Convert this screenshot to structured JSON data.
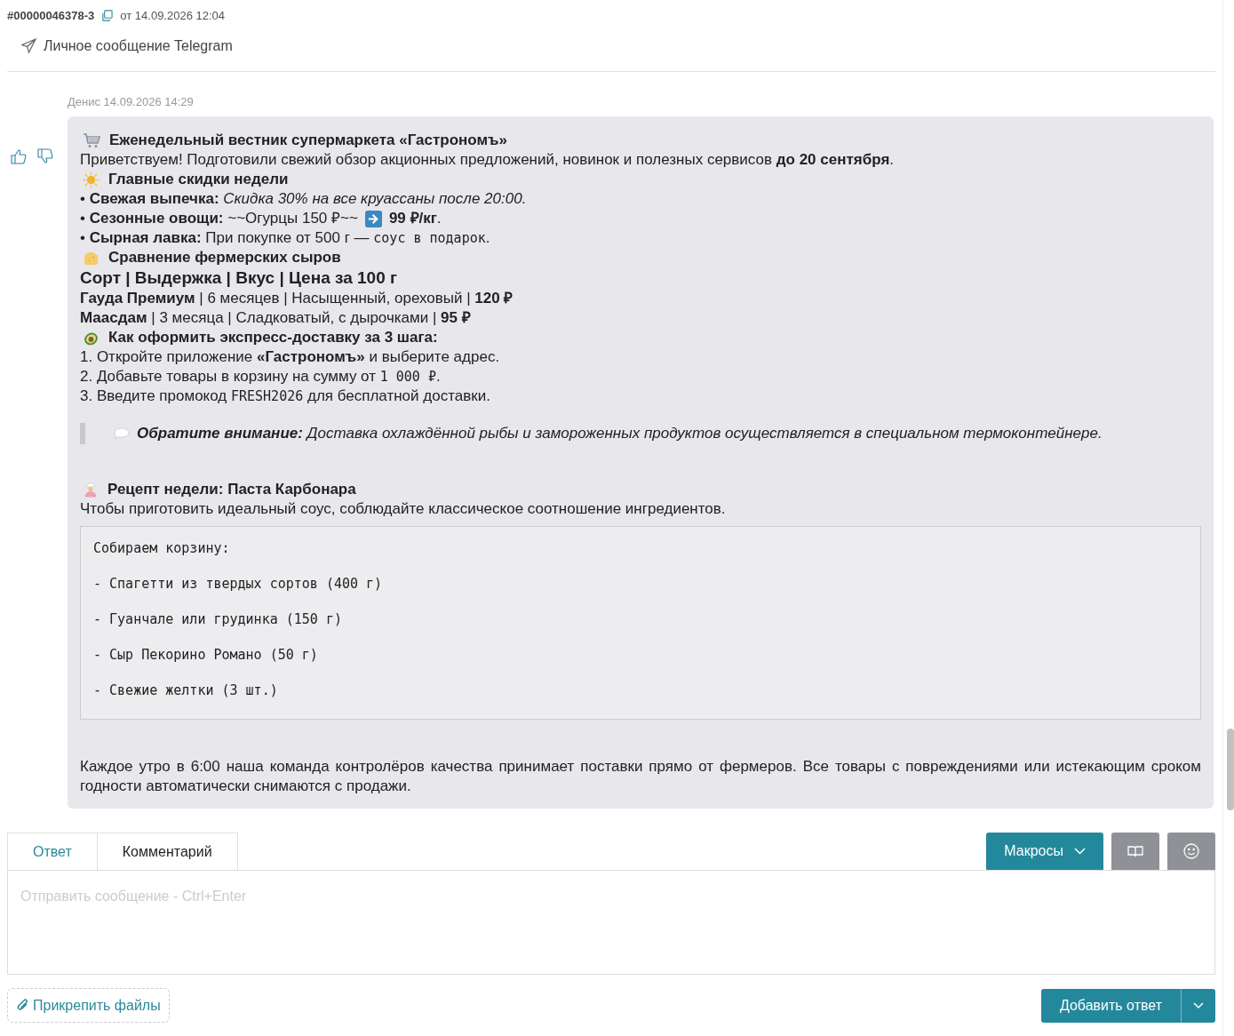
{
  "ticket": {
    "number": "#00000046378-3",
    "date": "от 14.09.2026 12:04",
    "channel": "Личное сообщение Telegram"
  },
  "message": {
    "author": "Денис 14.09.2026 14:29",
    "blocks": [
      {
        "kind": "heading",
        "text": "Еженедельный вестник супермаркета «Гастрономъ»"
      },
      {
        "kind": "line",
        "parts": [
          {
            "kind": "text",
            "text": "Приветствуем! Подготовили свежий обзор акционных предложений, новинок и полезных сервисов **до 20 сентября**."
          }
        ]
      },
      {
        "kind": "heading",
        "text": "Главные скидки недели"
      },
      {
        "kind": "line",
        "parts": [
          {
            "kind": "text",
            "text": "• **Свежая выпечка:** *Скидка 30% на все круассаны после 20:00.*"
          }
        ]
      },
      {
        "kind": "line",
        "parts": [
          {
            "kind": "text",
            "text": "• **Сезонные овощи:** ~~Огурцы 150 ₽~~"
          },
          {
            "kind": "icon"
          },
          {
            "kind": "text",
            "text": "**99 ₽/кг**."
          }
        ]
      },
      {
        "kind": "line",
        "parts": [
          {
            "kind": "text",
            "text": "• **Сырная лавка:** При покупке от 500 г — "
          },
          {
            "kind": "code",
            "text": "соус в подарок"
          },
          {
            "kind": "text",
            "text": "."
          }
        ]
      },
      {
        "kind": "heading",
        "text": "Сравнение фермерских сыров"
      },
      {
        "kind": "table_head",
        "text": "Сорт | Выдержка | Вкус | Цена за 100 г"
      },
      {
        "kind": "line",
        "parts": [
          {
            "kind": "text",
            "text": "**Гауда Премиум** | 6 месяцев | Насыщенный, ореховый | **120 ₽**"
          }
        ]
      },
      {
        "kind": "line",
        "parts": [
          {
            "kind": "text",
            "text": "**Маасдам** | 3 месяца | Сладковатый, с дырочками | **95 ₽**"
          }
        ]
      },
      {
        "kind": "heading",
        "text": "Как оформить экспресс-доставку за 3 шага:"
      },
      {
        "kind": "line",
        "parts": [
          {
            "kind": "text",
            "text": "1. Откройте приложение **«Гастрономъ»** и выберите адрес."
          }
        ]
      },
      {
        "kind": "line",
        "parts": [
          {
            "kind": "text",
            "text": "2. Добавьте товары в корзину на сумму от "
          },
          {
            "kind": "code",
            "text": "1 000 ₽"
          },
          {
            "kind": "text",
            "text": "."
          }
        ]
      },
      {
        "kind": "line",
        "parts": [
          {
            "kind": "text",
            "text": "3. Введите промокод "
          },
          {
            "kind": "code",
            "text": "FRESH2026"
          },
          {
            "kind": "text",
            "text": " для бесплатной доставки."
          }
        ]
      },
      {
        "kind": "quote",
        "text": "**Обратите внимание:** Доставка охлаждённой рыбы и замороженных продуктов осуществляется в специальном термоконтейнере."
      },
      {
        "kind": "heading",
        "text": "Рецепт недели: Паста Карбонара"
      },
      {
        "kind": "line",
        "parts": [
          {
            "kind": "text",
            "text": "Чтобы приготовить идеальный соус, соблюдайте классическое соотношение ингредиентов."
          }
        ]
      },
      {
        "kind": "code",
        "lines": [
          "Собираем корзину:",
          "- Спагетти из твердых сортов (400 г)",
          "- Гуанчале или грудинка (150 г)",
          "- Сыр Пекорино Романо (50 г)",
          "- Свежие желтки (3 шт.)"
        ]
      },
      {
        "kind": "paragraph",
        "text": "Каждое утро в 6:00 наша команда контролёров качества принимает поставки прямо от фермеров. Все товары с повреждениями или истекающим сроком годности автоматически снимаются с продажи."
      }
    ]
  },
  "reply": {
    "tabs": [
      {
        "label": "Ответ",
        "selected": true
      },
      {
        "label": "Комментарий",
        "selected": false
      }
    ],
    "macros": "Макросы",
    "placeholder": "Отправить сообщение - Ctrl+Enter",
    "attach": "Прикрепить файлы",
    "submit": "Добавить ответ"
  }
}
